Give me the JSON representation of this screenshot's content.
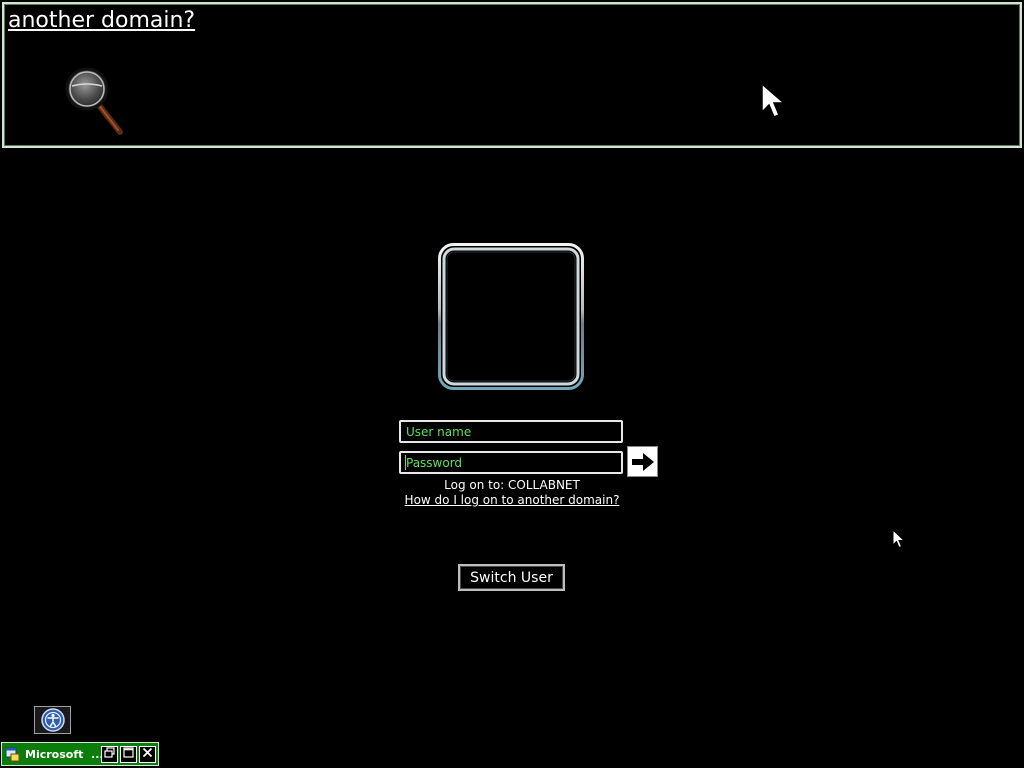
{
  "magnifier": {
    "text": "another domain?"
  },
  "login": {
    "username_placeholder": "User name",
    "password_placeholder": "Password",
    "logon_to_prefix": "Log on to: ",
    "logon_to_value": "COLLABNET",
    "help_link": "How do I log on to another domain?",
    "switch_user": "Switch User"
  },
  "taskbar": {
    "window_title": "Microsoft  ..."
  },
  "icons": {
    "magnifier": "magnifying-glass-icon",
    "submit": "arrow-right-icon",
    "ease_of_access": "ease-of-access-icon",
    "window_app": "window-app-icon",
    "restore": "restore-icon",
    "maximize": "maximize-icon",
    "close": "close-icon"
  },
  "colors": {
    "background": "#000000",
    "field_text": "#5fe05f",
    "magnifier_border": "#cfe6cf",
    "taskbar_green": "#0b7d0b"
  }
}
